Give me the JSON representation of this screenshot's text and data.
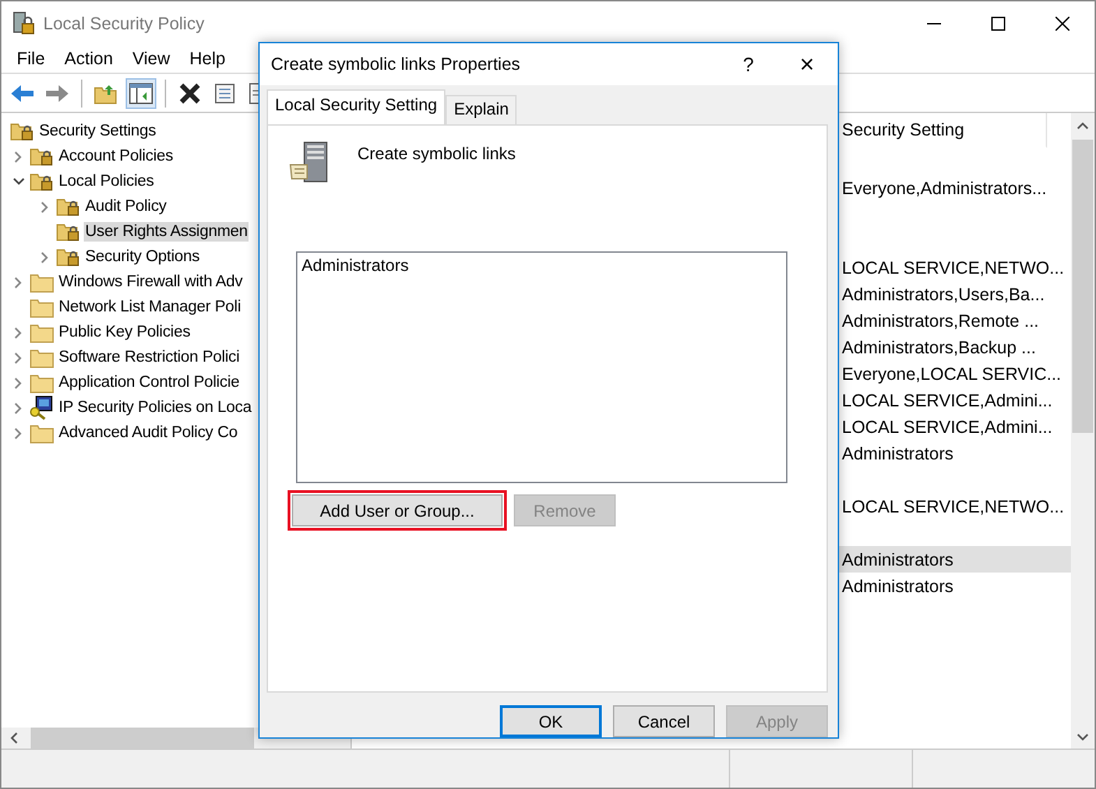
{
  "window": {
    "title": "Local Security Policy"
  },
  "menu": [
    "File",
    "Action",
    "View",
    "Help"
  ],
  "toolbar": [
    {
      "kind": "back",
      "disabled": false
    },
    {
      "kind": "forward",
      "disabled": true
    },
    {
      "kind": "separator"
    },
    {
      "kind": "up"
    },
    {
      "kind": "pane"
    },
    {
      "kind": "separator"
    },
    {
      "kind": "delete"
    },
    {
      "kind": "properties"
    },
    {
      "kind": "export"
    }
  ],
  "tree": {
    "label": "Security Settings",
    "children": [
      {
        "label": "Account Policies",
        "kind": "locked",
        "expanded": false,
        "has_children": true,
        "selected": false
      },
      {
        "label": "Local Policies",
        "kind": "locked",
        "expanded": true,
        "has_children": true,
        "selected": false,
        "children": [
          {
            "label": "Audit Policy",
            "kind": "locked",
            "expanded": false,
            "has_children": true,
            "selected": false
          },
          {
            "label": "User Rights Assignmen",
            "kind": "locked",
            "has_children": false,
            "selected": true
          },
          {
            "label": "Security Options",
            "kind": "locked",
            "expanded": false,
            "has_children": true,
            "selected": false
          }
        ]
      },
      {
        "label": "Windows Firewall with Adv",
        "kind": "folder",
        "expanded": false,
        "has_children": true,
        "selected": false
      },
      {
        "label": "Network List Manager Poli",
        "kind": "folder",
        "has_children": false,
        "selected": false
      },
      {
        "label": "Public Key Policies",
        "kind": "folder",
        "expanded": false,
        "has_children": true,
        "selected": false
      },
      {
        "label": "Software Restriction Polici",
        "kind": "folder",
        "expanded": false,
        "has_children": true,
        "selected": false
      },
      {
        "label": "Application Control Policie",
        "kind": "folder",
        "expanded": false,
        "has_children": true,
        "selected": false
      },
      {
        "label": "IP Security Policies on Loca",
        "kind": "computer",
        "expanded": false,
        "has_children": true,
        "selected": false
      },
      {
        "label": "Advanced Audit Policy Co",
        "kind": "folder",
        "expanded": false,
        "has_children": true,
        "selected": false
      }
    ]
  },
  "list": {
    "columns": [
      "Security Setting"
    ],
    "rows": [
      {
        "selected": false
      },
      {
        "security_setting": "Everyone,Administrators...",
        "selected": false
      },
      {
        "selected": false
      },
      {
        "selected": false
      },
      {
        "security_setting": "LOCAL SERVICE,NETWO...",
        "selected": false
      },
      {
        "security_setting": "Administrators,Users,Ba...",
        "selected": false
      },
      {
        "security_setting": "Administrators,Remote ...",
        "selected": false
      },
      {
        "security_setting": "Administrators,Backup ...",
        "selected": false
      },
      {
        "security_setting": "Everyone,LOCAL SERVIC...",
        "selected": false
      },
      {
        "security_setting": "LOCAL SERVICE,Admini...",
        "selected": false
      },
      {
        "security_setting": "LOCAL SERVICE,Admini...",
        "selected": false
      },
      {
        "security_setting": "Administrators",
        "selected": false
      },
      {
        "selected": false
      },
      {
        "security_setting": "LOCAL SERVICE,NETWO...",
        "selected": false
      },
      {
        "selected": false
      },
      {
        "security_setting": "Administrators",
        "selected": true
      },
      {
        "security_setting": "Administrators",
        "selected": false
      }
    ]
  },
  "dialog": {
    "title": "Create symbolic links Properties",
    "help": "?",
    "close": "×",
    "tabs": [
      {
        "label": "Local Security Setting",
        "selected": true
      },
      {
        "label": "Explain",
        "selected": false
      }
    ],
    "policy_name": "Create symbolic links",
    "members": [
      {
        "name": "Administrators",
        "selected": false
      }
    ],
    "member_buttons": [
      {
        "label": "Add User or Group...",
        "disabled": false,
        "highlighted": true
      },
      {
        "label": "Remove",
        "disabled": true,
        "highlighted": false
      }
    ],
    "buttons": [
      {
        "label": "OK",
        "disabled": false,
        "default": true
      },
      {
        "label": "Cancel",
        "disabled": false,
        "default": false
      },
      {
        "label": "Apply",
        "disabled": true,
        "default": false
      }
    ]
  }
}
